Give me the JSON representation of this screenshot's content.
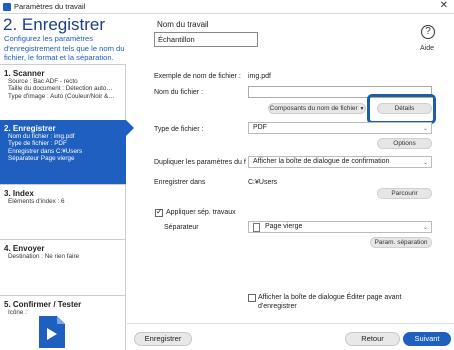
{
  "window": {
    "title": "Paramètres du travail",
    "close_glyph": "✕"
  },
  "header": {
    "title": "2. Enregistrer",
    "description": "Configurez les paramètres d'enregistrement tels que le nom du fichier, le format et la séparation.",
    "job_name_label": "Nom du travail",
    "job_name_value": "Échantillon",
    "help_label": "Aide",
    "help_glyph": "?"
  },
  "sidebar": {
    "steps": [
      {
        "title": "1. Scanner",
        "details": [
          "Source : Bac ADF - recto",
          "Taille du document : Détection auto…",
          "Type d'image : Auto (Couleur/Noir &…"
        ]
      },
      {
        "title": "2. Enregistrer",
        "details": [
          "Nom du fichier : img.pdf",
          "Type de fichier : PDF",
          "Enregistrer dans C:¥Users",
          "Séparateur Page vierge"
        ]
      },
      {
        "title": "3. Index",
        "details": [
          "Éléments d'index : 6"
        ]
      },
      {
        "title": "4. Envoyer",
        "details": [
          "Destination : Ne rien faire"
        ]
      },
      {
        "title": "5. Confirmer / Tester",
        "details": [
          "Icône :"
        ]
      }
    ]
  },
  "main": {
    "filename_example_label": "Exemple de nom de fichier :",
    "filename_example_value": "img.pdf",
    "filename_label": "Nom du fichier :",
    "filename_value": "",
    "components_button": "Composants du nom de fichier",
    "details_button": "Détails",
    "filetype_label": "Type de fichier :",
    "filetype_value": "PDF",
    "options_button": "Options",
    "duplicate_label": "Dupliquer les paramètres du f",
    "duplicate_value": "Afficher la boîte de dialogue de confirmation",
    "save_in_label": "Enregistrer dans",
    "save_in_value": "C:¥Users",
    "browse_button": "Parcourir",
    "apply_sep_label": "Appliquer sép. travaux",
    "apply_sep_checked": true,
    "separator_label": "Séparateur",
    "separator_value": "Page vierge",
    "separator_params_button": "Param. séparation",
    "show_edit_page_label_1": "Afficher la boîte de dialogue Éditer page avant",
    "show_edit_page_label_2": "d'enregistrer",
    "show_edit_page_checked": false
  },
  "footer": {
    "save_button": "Enregistrer",
    "back_button": "Retour",
    "next_button": "Suivant"
  },
  "colors": {
    "accent": "#1f5fbf",
    "title": "#1a3f8a",
    "highlight": "#1a5fa8"
  },
  "icons": [
    "app-icon",
    "close-icon",
    "help-icon",
    "save-step-icon",
    "file-icon",
    "chevron-down-icon",
    "page-icon"
  ]
}
